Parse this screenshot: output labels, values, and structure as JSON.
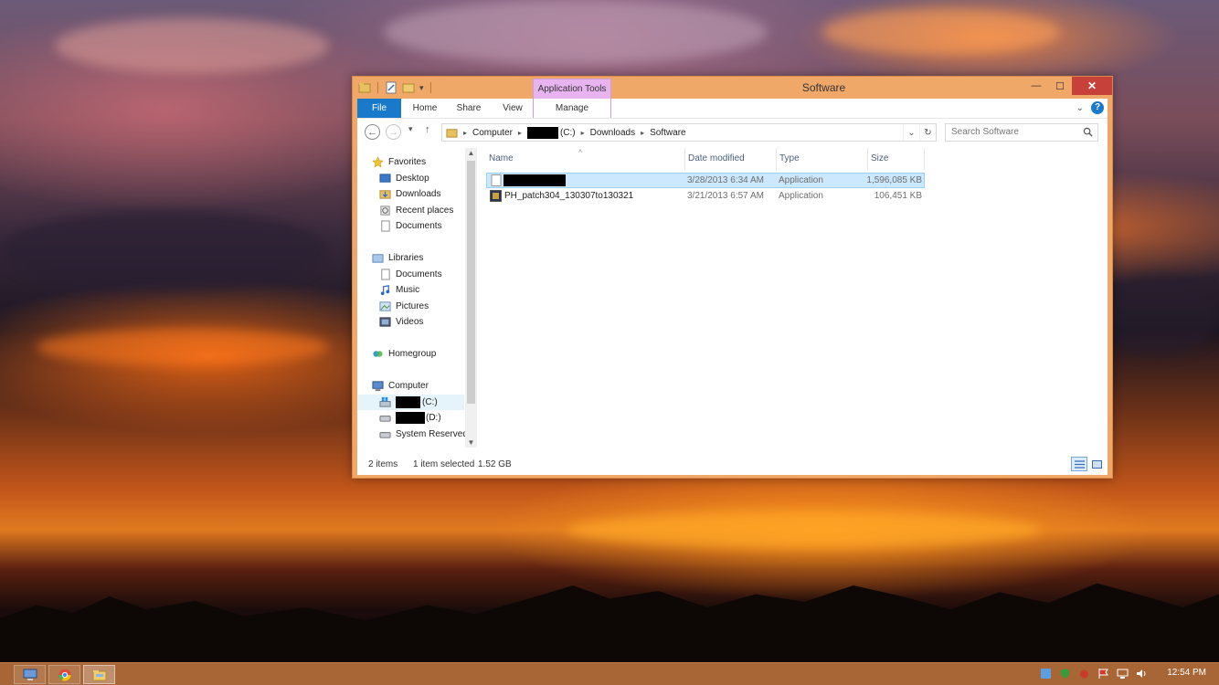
{
  "window": {
    "title": "Software",
    "contextual_group": "Application Tools",
    "tabs": [
      {
        "label": "File"
      },
      {
        "label": "Home"
      },
      {
        "label": "Share"
      },
      {
        "label": "View"
      },
      {
        "label": "Manage"
      }
    ],
    "controls": {
      "minimize": "—",
      "maximize": "☐",
      "close": "✕"
    }
  },
  "address": {
    "crumbs": [
      "Computer",
      "(C:)",
      "Downloads",
      "Software"
    ]
  },
  "search": {
    "placeholder": "Search Software"
  },
  "nav": {
    "favorites": {
      "label": "Favorites",
      "items": [
        "Desktop",
        "Downloads",
        "Recent places",
        "Documents"
      ]
    },
    "libraries": {
      "label": "Libraries",
      "items": [
        "Documents",
        "Music",
        "Pictures",
        "Videos"
      ]
    },
    "homegroup": {
      "label": "Homegroup"
    },
    "computer": {
      "label": "Computer",
      "drives": [
        "(C:)",
        "(D:)",
        "System Reserved"
      ]
    }
  },
  "columns": [
    "Name",
    "Date modified",
    "Type",
    "Size"
  ],
  "files": [
    {
      "name": "",
      "redacted": true,
      "date": "3/28/2013 6:34 AM",
      "type": "Application",
      "size": "1,596,085 KB",
      "selected": true
    },
    {
      "name": "PH_patch304_130307to130321",
      "redacted": false,
      "date": "3/21/2013 6:57 AM",
      "type": "Application",
      "size": "106,451 KB",
      "selected": false
    }
  ],
  "status": {
    "items": "2 items",
    "selected": "1 item selected",
    "size": "1.52 GB"
  },
  "taskbar": {
    "clock": "12:54 PM"
  },
  "colors": {
    "accent": "#1979ca",
    "frame": "#f0a868",
    "taskbar": "#a86636",
    "selection": "#cce8ff",
    "contextual": "#e8b4ef"
  }
}
